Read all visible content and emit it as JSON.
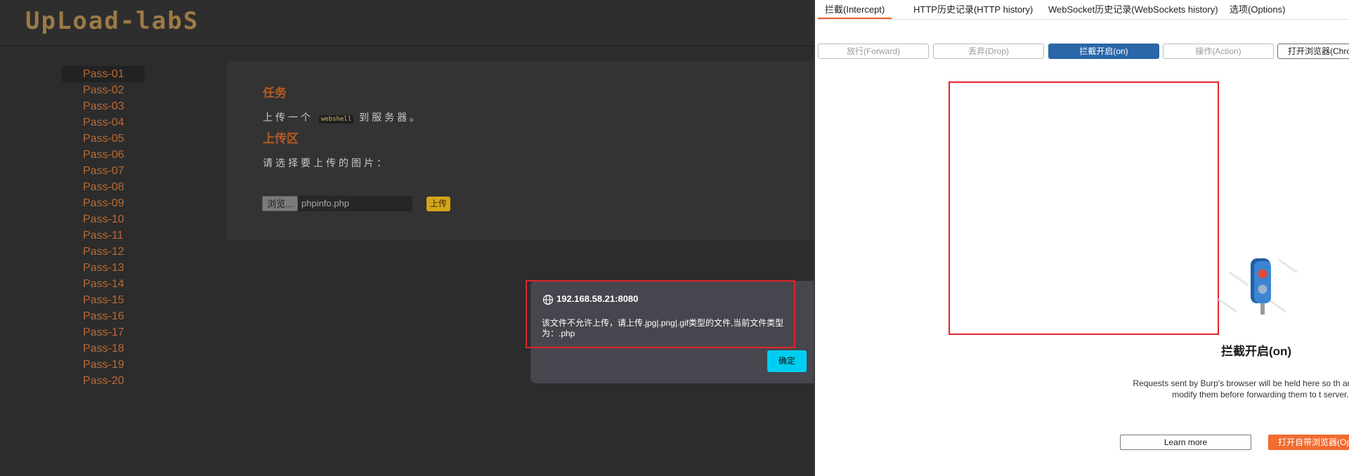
{
  "app": {
    "logo": "UpLoad-labS",
    "nav": [
      "Pass-01",
      "Pass-02",
      "Pass-03",
      "Pass-04",
      "Pass-05",
      "Pass-06",
      "Pass-07",
      "Pass-08",
      "Pass-09",
      "Pass-10",
      "Pass-11",
      "Pass-12",
      "Pass-13",
      "Pass-14",
      "Pass-15",
      "Pass-16",
      "Pass-17",
      "Pass-18",
      "Pass-19",
      "Pass-20"
    ],
    "task_heading": "任务",
    "task_text_before": "上传一个",
    "task_code": "webshell",
    "task_text_after": "到服务器。",
    "upload_heading": "上传区",
    "upload_prompt": "请选择要上传的图片：",
    "browse_label": "浏览...",
    "file_name": "phpinfo.php",
    "upload_label": "上传"
  },
  "dialog": {
    "host": "192.168.58.21:8080",
    "message": "该文件不允许上传，请上传.jpg|.png|.gif类型的文件,当前文件类型为：.php",
    "ok_label": "确定",
    "icon": "globe-icon"
  },
  "burp": {
    "tabs": [
      "拦截(Intercept)",
      "HTTP历史记录(HTTP history)",
      "WebSocket历史记录(WebSockets history)",
      "选项(Options)"
    ],
    "toolbar": {
      "forward": "放行(Forward)",
      "drop": "丢弃(Drop)",
      "intercept": "拦截开启(on)",
      "action": "操作(Action)",
      "open_browser": "打开浏览器(Chro"
    },
    "intercept_title": "拦截开启(on)",
    "intercept_desc": "Requests sent by Burp's browser will be held here so th analyze and modify them before forwarding them to t server.",
    "learn_more": "Learn more",
    "open_embedded": "打开自带浏览器(Op",
    "accent": "#e8632b",
    "on_color": "#2a66a8"
  }
}
